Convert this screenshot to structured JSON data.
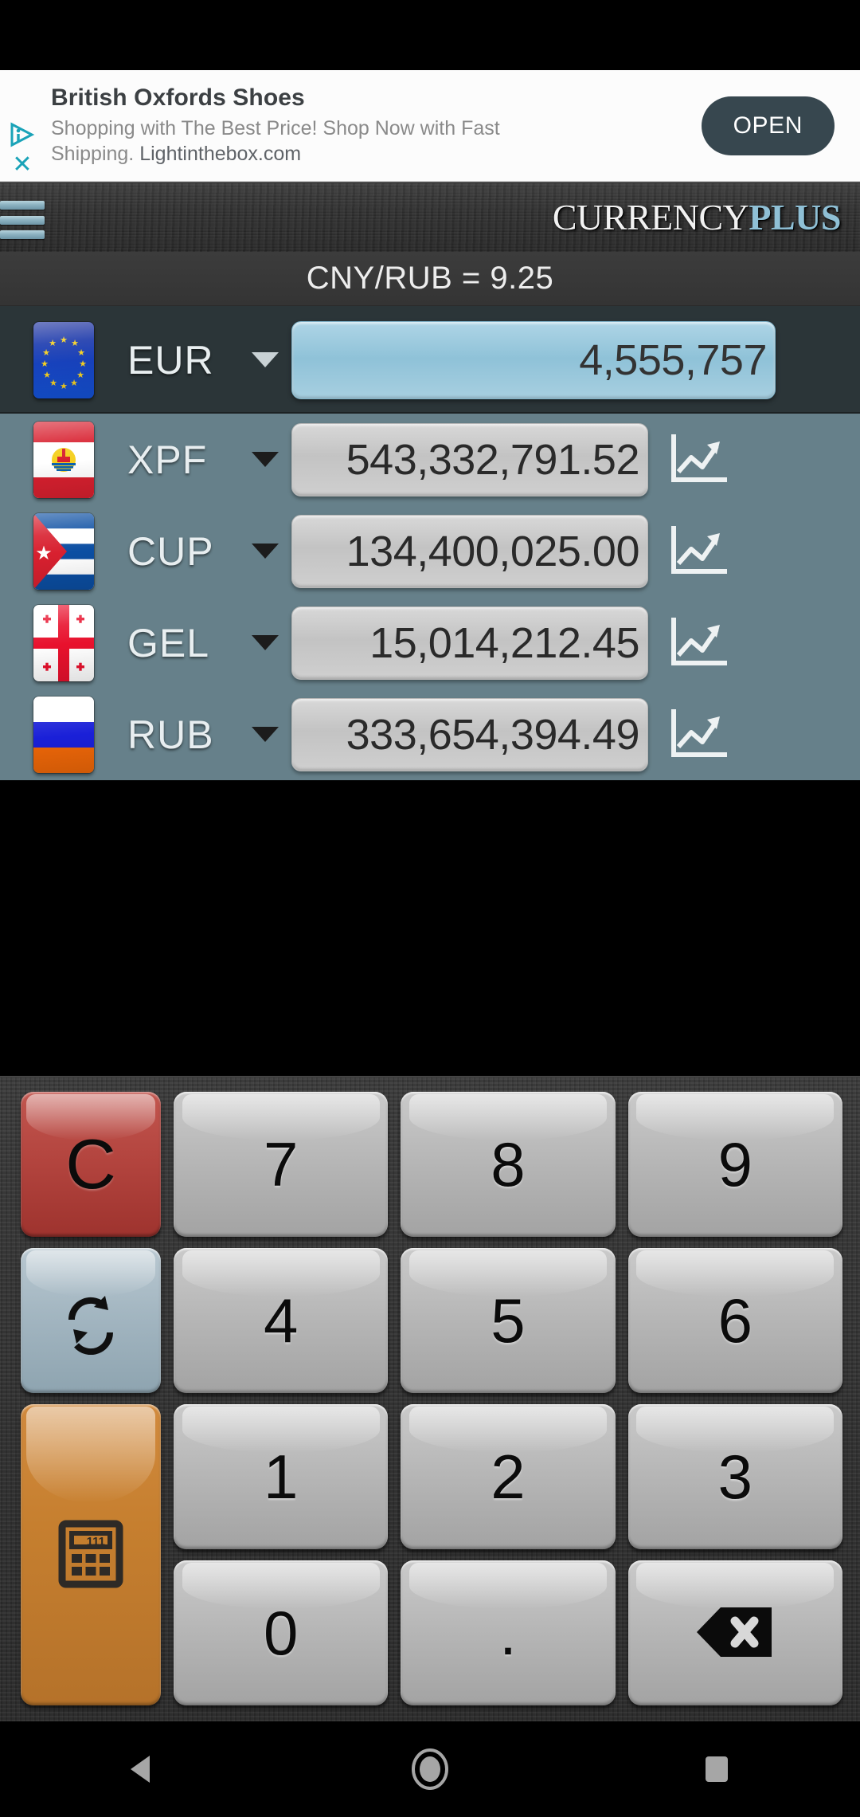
{
  "statusbar": {
    "height": 88
  },
  "ad": {
    "title": "British Oxfords Shoes",
    "description_line1": "Shopping with The Best Price! Shop Now with Fast",
    "description_line2_prefix": "Shipping. ",
    "domain": "Lightinthebox.com",
    "open_label": "OPEN",
    "adchoices_icon": "adchoices-triangle-icon",
    "close_icon": "close-icon",
    "open_button_color": "#37474f"
  },
  "appbar": {
    "menu_icon": "hamburger-menu-icon",
    "brand_part1": "CURRENCY",
    "brand_part2": "PLUS",
    "brand_part1_color": "#f2f2f2",
    "brand_part2_color": "#8fc0d6"
  },
  "rate": {
    "text": "CNY/RUB = 9.25"
  },
  "list": {
    "background_color": "#66808a",
    "active_background_color": "#2b3538",
    "active_input_color": "#8fc2d8",
    "rows": [
      {
        "code": "EUR",
        "amount": "4,555,757",
        "flag": "flag-european-union",
        "active": true,
        "caret_icon": "chevron-down-icon",
        "chart_icon": null
      },
      {
        "code": "XPF",
        "amount": "543,332,791.52",
        "flag": "flag-french-polynesia",
        "active": false,
        "caret_icon": "chevron-down-icon",
        "chart_icon": "line-chart-icon"
      },
      {
        "code": "CUP",
        "amount": "134,400,025.00",
        "flag": "flag-cuba",
        "active": false,
        "caret_icon": "chevron-down-icon",
        "chart_icon": "line-chart-icon"
      },
      {
        "code": "GEL",
        "amount": "15,014,212.45",
        "flag": "flag-georgia",
        "active": false,
        "caret_icon": "chevron-down-icon",
        "chart_icon": "line-chart-icon"
      },
      {
        "code": "RUB",
        "amount": "333,654,394.49",
        "flag": "flag-russia",
        "active": false,
        "caret_icon": "chevron-down-icon",
        "chart_icon": "line-chart-icon"
      }
    ]
  },
  "keypad": {
    "clear_label": "C",
    "clear_color": "#b4453f",
    "swap_icon": "refresh-sync-icon",
    "swap_color": "#a3b6c1",
    "calculator_icon": "calculator-icon",
    "calculator_icon_display": "111",
    "calculator_color": "#c67f2f",
    "backspace_icon": "backspace-delete-icon",
    "key_color": "#b6b6b6",
    "keys": {
      "seven": "7",
      "eight": "8",
      "nine": "9",
      "four": "4",
      "five": "5",
      "six": "6",
      "one": "1",
      "two": "2",
      "three": "3",
      "zero": "0",
      "dot": "."
    }
  },
  "navbar": {
    "back_icon": "back-triangle-icon",
    "home_icon": "home-circle-icon",
    "recents_icon": "recents-square-icon"
  }
}
